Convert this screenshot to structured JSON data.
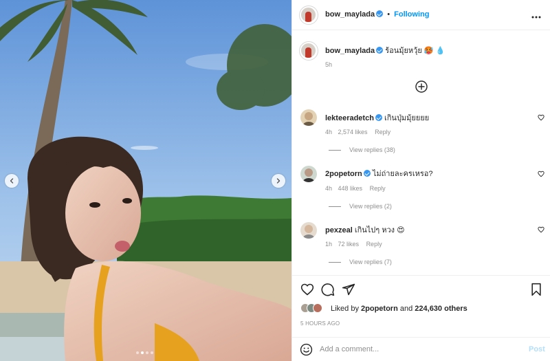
{
  "post": {
    "carousel": {
      "slide_count": 4,
      "active_slide": 2
    },
    "author": {
      "username": "bow_maylada",
      "verified": true,
      "follow_label": "Following",
      "separator": "•"
    },
    "caption": {
      "username": "bow_maylada",
      "text": "ร้อนมุ้ยหวุ้ย 🥵 💧",
      "time": "5h"
    },
    "more_icon": "more-horizontal-icon"
  },
  "comments": [
    {
      "username": "lekteeradetch",
      "verified": true,
      "text": "เกินปุ่มมุ้ยยยย",
      "time": "4h",
      "likes": "2,574 likes",
      "reply_label": "Reply",
      "view_replies": "View replies (38)"
    },
    {
      "username": "2popetorn",
      "verified": true,
      "text": "ไม่ถ่ายละครเหรอ?",
      "time": "4h",
      "likes": "448 likes",
      "reply_label": "Reply",
      "view_replies": "View replies (2)"
    },
    {
      "username": "pexzeal",
      "verified": false,
      "text": "เกินไปๆ หวง 😍",
      "time": "1h",
      "likes": "72 likes",
      "reply_label": "Reply",
      "view_replies": "View replies (7)"
    }
  ],
  "actions": {
    "like_icon": "heart-icon",
    "comment_icon": "comment-icon",
    "share_icon": "paper-plane-icon",
    "save_icon": "bookmark-icon"
  },
  "likes": {
    "prefix": "Liked by ",
    "user": "2popetorn",
    "middle": " and ",
    "count": "224,630 others"
  },
  "timestamp": "5 HOURS AGO",
  "add_comment": {
    "placeholder": "Add a comment...",
    "post_label": "Post",
    "emoji_icon": "smiley-icon"
  },
  "colors": {
    "link_blue": "#0095f6",
    "verified_blue": "#3897f0",
    "muted": "#8e8e8e",
    "post_disabled": "#b2dffc"
  }
}
